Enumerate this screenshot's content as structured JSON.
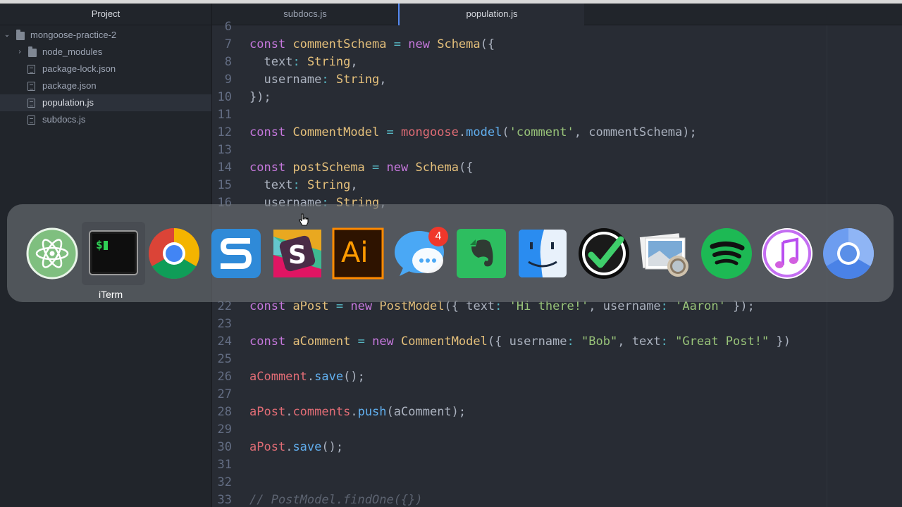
{
  "sidebar": {
    "title": "Project",
    "tree": [
      {
        "label": "mongoose-practice-2",
        "type": "root-folder",
        "expanded": true
      },
      {
        "label": "node_modules",
        "type": "folder",
        "expanded": false
      },
      {
        "label": "package-lock.json",
        "type": "file"
      },
      {
        "label": "package.json",
        "type": "file"
      },
      {
        "label": "population.js",
        "type": "file",
        "selected": true
      },
      {
        "label": "subdocs.js",
        "type": "file"
      }
    ]
  },
  "tabs": [
    {
      "label": "subdocs.js",
      "active": false
    },
    {
      "label": "population.js",
      "active": true
    }
  ],
  "editor": {
    "lines": [
      {
        "n": "6",
        "code": ""
      },
      {
        "n": "7",
        "code": "const commentSchema = new Schema({"
      },
      {
        "n": "8",
        "code": "  text: String,"
      },
      {
        "n": "9",
        "code": "  username: String,"
      },
      {
        "n": "10",
        "code": "});"
      },
      {
        "n": "11",
        "code": ""
      },
      {
        "n": "12",
        "code": "const CommentModel = mongoose.model('comment', commentSchema);"
      },
      {
        "n": "13",
        "code": ""
      },
      {
        "n": "14",
        "code": "const postSchema = new Schema({"
      },
      {
        "n": "15",
        "code": "  text: String,"
      },
      {
        "n": "16",
        "code": "  username: String,"
      },
      {
        "n": "22",
        "code": "const aPost = new PostModel({ text: 'Hi there!', username: 'Aaron' });"
      },
      {
        "n": "23",
        "code": ""
      },
      {
        "n": "24",
        "code": "const aComment = new CommentModel({ username: \"Bob\", text: \"Great Post!\" })"
      },
      {
        "n": "25",
        "code": ""
      },
      {
        "n": "26",
        "code": "aComment.save();"
      },
      {
        "n": "27",
        "code": ""
      },
      {
        "n": "28",
        "code": "aPost.comments.push(aComment);"
      },
      {
        "n": "29",
        "code": ""
      },
      {
        "n": "30",
        "code": "aPost.save();"
      },
      {
        "n": "31",
        "code": ""
      },
      {
        "n": "32",
        "code": ""
      },
      {
        "n": "33",
        "code": "// PostModel.findOne({})"
      }
    ]
  },
  "dock": {
    "apps": [
      {
        "name": "Atom",
        "icon": "atom-icon"
      },
      {
        "name": "iTerm",
        "icon": "iterm-icon",
        "focused": true
      },
      {
        "name": "Google Chrome",
        "icon": "chrome-icon"
      },
      {
        "name": "Snagit",
        "icon": "snagit-icon"
      },
      {
        "name": "Slack",
        "icon": "slack-icon"
      },
      {
        "name": "Adobe Illustrator",
        "icon": "illustrator-icon",
        "label": "Ai"
      },
      {
        "name": "Messages",
        "icon": "messages-icon",
        "badge": "4"
      },
      {
        "name": "Evernote",
        "icon": "evernote-icon"
      },
      {
        "name": "Finder",
        "icon": "finder-icon"
      },
      {
        "name": "Wunderlist",
        "icon": "checkmark-icon"
      },
      {
        "name": "Preview",
        "icon": "preview-icon"
      },
      {
        "name": "Spotify",
        "icon": "spotify-icon"
      },
      {
        "name": "iTunes",
        "icon": "itunes-icon"
      },
      {
        "name": "Chromium",
        "icon": "chromium-icon"
      }
    ],
    "tooltip": "iTerm",
    "badge_count": "4",
    "illustrator_label": "Ai",
    "iterm_prompt": "$"
  },
  "colors": {
    "editor_bg": "#282c34",
    "sidebar_bg": "#21252b",
    "tab_accent": "#568af2",
    "keyword": "#c678dd",
    "string": "#98c379",
    "function": "#61afef"
  }
}
